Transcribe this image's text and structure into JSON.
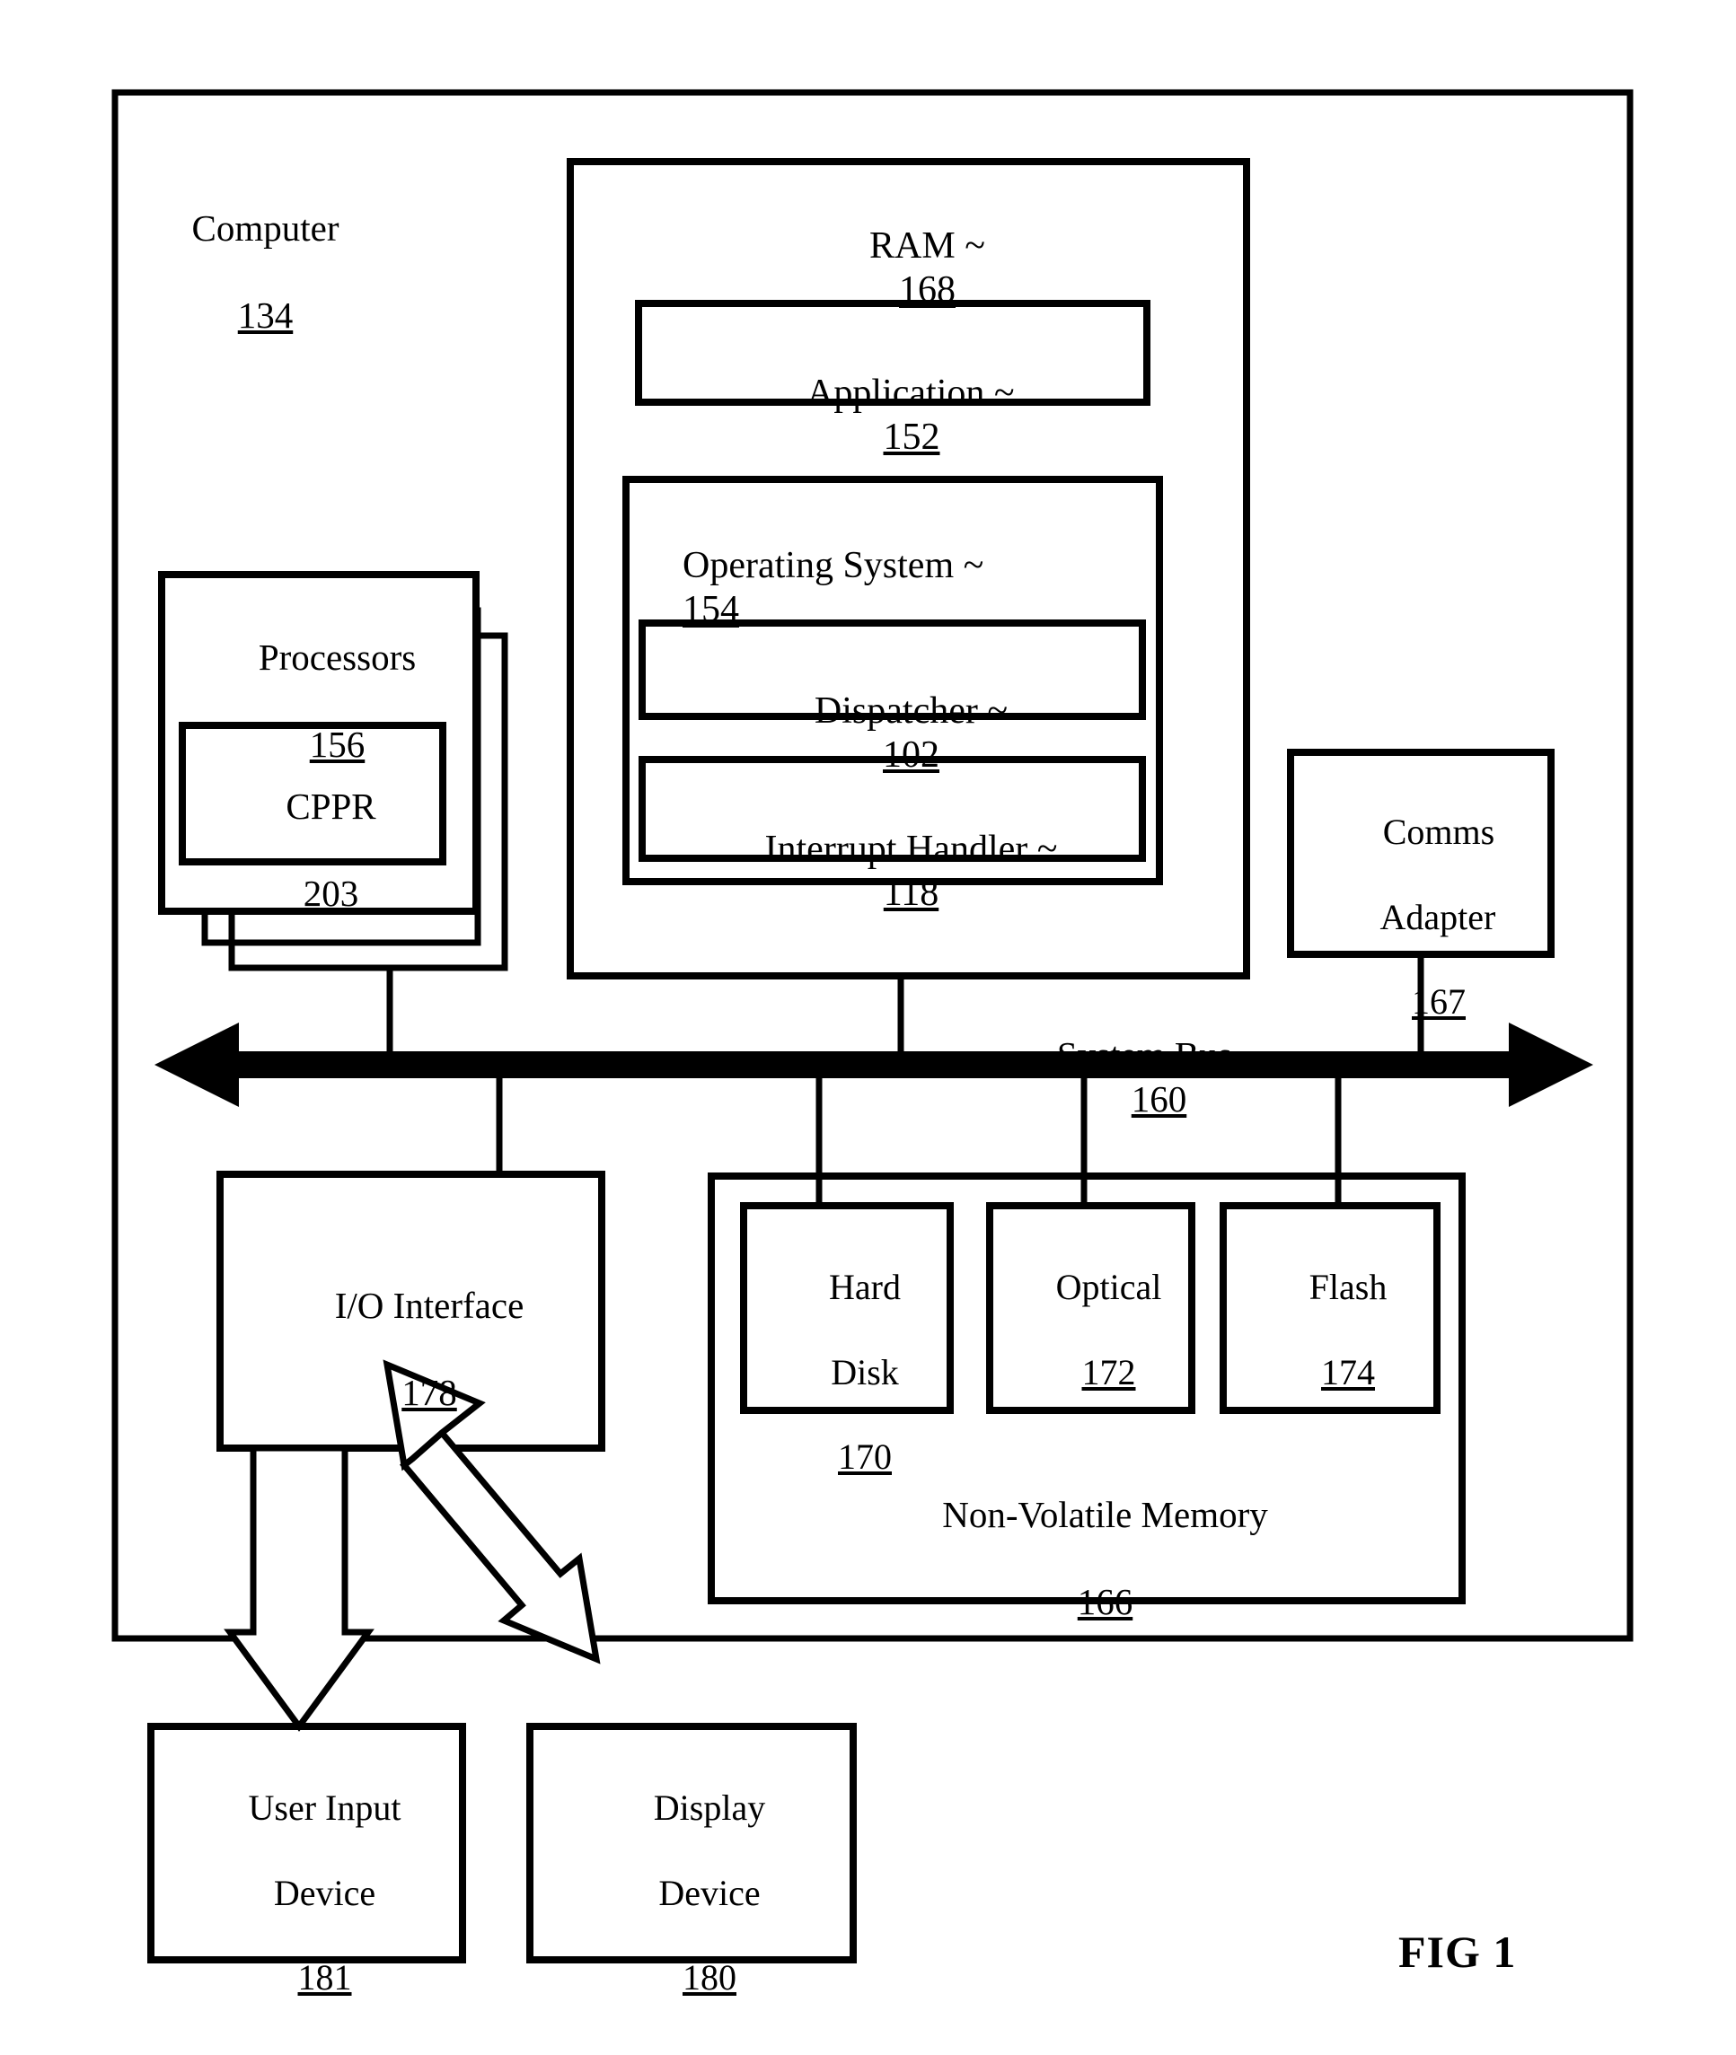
{
  "figure": {
    "caption": "FIG 1",
    "stroke_color": "#000000",
    "background_color": "#ffffff"
  },
  "computer": {
    "title": "Computer",
    "ref": "134"
  },
  "ram": {
    "title": "RAM ~",
    "ref": "168",
    "application": {
      "title": "Application ~",
      "ref": "152"
    },
    "operating_system": {
      "title": "Operating System ~",
      "ref": "154",
      "dispatcher": {
        "title": "Dispatcher ~",
        "ref": "102"
      },
      "interrupt_handler": {
        "title": "Interrupt Handler ~",
        "ref": "118"
      }
    }
  },
  "processors": {
    "title": "Processors",
    "ref": "156",
    "cppr": {
      "title": "CPPR",
      "ref": "203"
    },
    "stack_count": 3
  },
  "comms_adapter": {
    "line1": "Comms",
    "line2": "Adapter",
    "ref": "167"
  },
  "system_bus": {
    "title": "System Bus ~",
    "ref": "160"
  },
  "io_interface": {
    "title": "I/O Interface",
    "ref": "178"
  },
  "non_volatile_memory": {
    "title": "Non-Volatile Memory",
    "ref": "166",
    "devices": [
      {
        "line1": "Hard",
        "line2": "Disk",
        "ref": "170"
      },
      {
        "line1": "Optical",
        "line2": "",
        "ref": "172"
      },
      {
        "line1": "Flash",
        "line2": "",
        "ref": "174"
      }
    ]
  },
  "user_input_device": {
    "line1": "User Input",
    "line2": "Device",
    "ref": "181"
  },
  "display_device": {
    "line1": "Display",
    "line2": "Device",
    "ref": "180"
  }
}
